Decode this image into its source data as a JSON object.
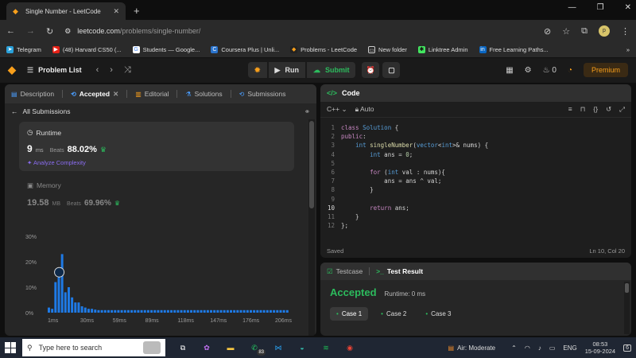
{
  "browser": {
    "tab_title": "Single Number - LeetCode",
    "url_host": "leetcode.com",
    "url_path": "/problems/single-number/",
    "profile_initials": "p",
    "bookmarks": [
      {
        "label": "Telegram",
        "color": "#2aa1da"
      },
      {
        "label": "(48) Harvard CS50 (...",
        "color": "#e62117"
      },
      {
        "label": "Students — Google...",
        "color": "#ffffff"
      },
      {
        "label": "Coursera Plus | Unli...",
        "color": "#2a73cc"
      },
      {
        "label": "Problems - LeetCode",
        "color": "#f89f1b"
      },
      {
        "label": "New folder",
        "color": "#cccccc"
      },
      {
        "label": "Linktree Admin",
        "color": "#43e660"
      },
      {
        "label": "Free Learning Paths...",
        "color": "#0a66c2"
      }
    ]
  },
  "lc_nav": {
    "problem_list": "Problem List",
    "run": "Run",
    "submit": "Submit",
    "streak": "0",
    "premium": "Premium"
  },
  "left_tabs": [
    {
      "label": "Description",
      "icon": "description-icon"
    },
    {
      "label": "Accepted",
      "icon": "accepted-icon"
    },
    {
      "label": "Editorial",
      "icon": "editorial-icon"
    },
    {
      "label": "Solutions",
      "icon": "solutions-icon"
    },
    {
      "label": "Submissions",
      "icon": "submissions-icon"
    }
  ],
  "submission": {
    "back_label": "All Submissions",
    "runtime": {
      "label": "Runtime",
      "value": "9",
      "unit": "ms",
      "beats_label": "Beats",
      "beats": "88.02%",
      "analyze": "Analyze Complexity"
    },
    "memory": {
      "label": "Memory",
      "value": "19.58",
      "unit": "MB",
      "beats_label": "Beats",
      "beats": "69.96%"
    }
  },
  "chart_data": {
    "type": "bar",
    "y_ticks": [
      "30%",
      "20%",
      "10%",
      "0%"
    ],
    "x_ticks": [
      "1ms",
      "30ms",
      "59ms",
      "89ms",
      "118ms",
      "147ms",
      "176ms",
      "206ms"
    ],
    "ylim": [
      0,
      30
    ],
    "values": [
      2,
      1.5,
      12,
      14,
      23,
      8,
      10,
      6,
      4,
      4,
      2.5,
      2,
      1.5,
      1.5,
      1.2,
      1,
      1,
      1,
      1,
      1,
      1,
      1,
      1,
      1,
      1,
      1,
      1,
      1,
      1,
      1,
      1,
      1,
      1,
      1,
      1,
      1,
      1,
      1,
      1,
      1,
      1,
      1,
      1,
      1,
      1,
      1,
      1,
      1,
      1,
      1,
      1,
      1,
      1,
      1,
      1,
      1,
      1,
      1,
      1,
      1,
      1,
      1,
      1,
      1,
      1,
      1,
      1,
      1,
      1,
      1,
      1,
      1,
      1
    ],
    "highlight_index": 3,
    "bar_color": "#1e7ae6"
  },
  "editor": {
    "title": "Code",
    "language": "C++",
    "mode": "Auto",
    "status": "Saved",
    "cursor": "Ln 10, Col 20"
  },
  "result_panel": {
    "testcase_tab": "Testcase",
    "result_tab": "Test Result",
    "status": "Accepted",
    "runtime": "Runtime: 0 ms",
    "cases": [
      "Case 1",
      "Case 2",
      "Case 3"
    ]
  },
  "taskbar": {
    "search_placeholder": "Type here to search",
    "whatsapp_badge": "83",
    "air": "Air: Moderate",
    "lang": "ENG",
    "time": "08:53",
    "date": "15-09-2024",
    "notif": "6"
  }
}
